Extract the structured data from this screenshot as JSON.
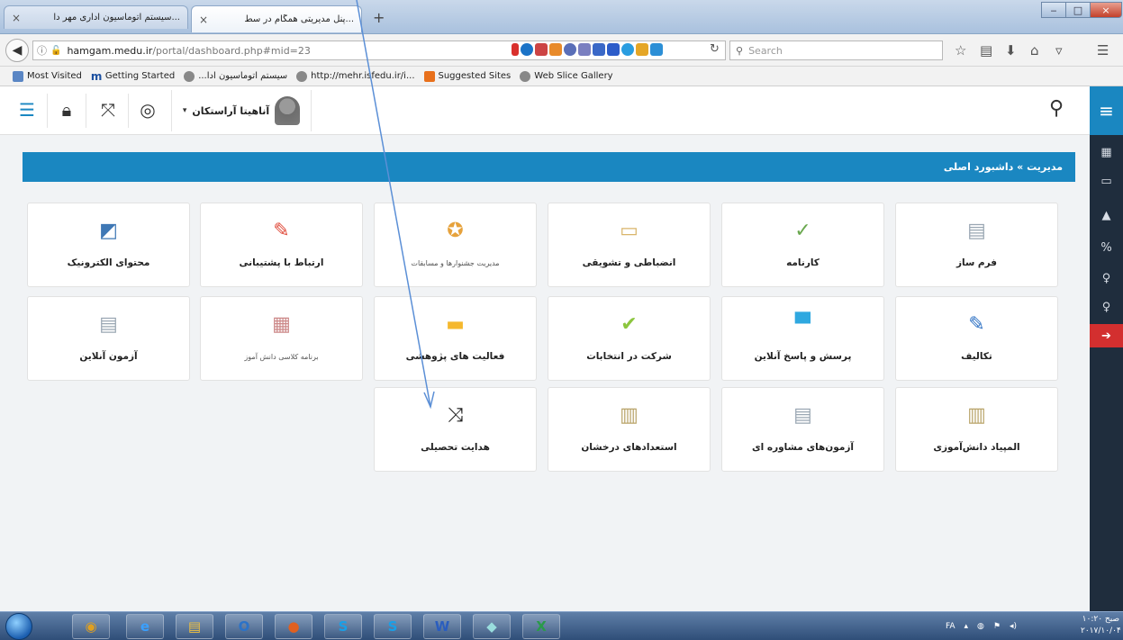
{
  "browser": {
    "tabs": [
      {
        "label": "...سیستم اتوماسیون اداری مهر دا",
        "close": "×"
      },
      {
        "label": "...پنل مدیریتی همگام در سط",
        "close": "×"
      }
    ],
    "new_tab": "+",
    "window_buttons": {
      "minimize": "‒",
      "maximize": "□",
      "close": "×"
    },
    "url_host": "hamgam.medu.ir",
    "url_path": "/portal/dashboard.php#mid=23",
    "search_placeholder": "Search",
    "bookmarks": [
      "Most Visited",
      "Getting Started",
      "...سیستم اتوماسیون ادا",
      "http://mehr.isfedu.ir/i...",
      "Suggested Sites",
      "Web Slice Gallery"
    ]
  },
  "header": {
    "user_name": "آناهیتا آراستکان",
    "user_caret": "▾"
  },
  "main": {
    "breadcrumb": "مدیریت » داشبورد اصلی",
    "tiles": [
      {
        "label": "فرم ساز",
        "icon": "form-icon",
        "color": "#9aa7b3"
      },
      {
        "label": "کارنامه",
        "icon": "report-card-icon",
        "color": "#6aa84f"
      },
      {
        "label": "انضباطی و تشویقی",
        "icon": "folder-doc-icon",
        "color": "#d9b56b"
      },
      {
        "label": "مدیریت جشنوارها و مسابقات",
        "icon": "award-icon",
        "color": "#e6a23c",
        "small": true
      },
      {
        "label": "ارتباط با پشتیبانی",
        "icon": "pencil-red-icon",
        "color": "#e04b3b"
      },
      {
        "label": "محتوای الکترونیک",
        "icon": "presentation-icon",
        "color": "#3f78b5"
      },
      {
        "label": "تکالیف",
        "icon": "pencil-blue-icon",
        "color": "#2f72c4"
      },
      {
        "label": "پرسش و پاسخ آنلاین",
        "icon": "chat-bubble-icon",
        "color": "#2fa8e0"
      },
      {
        "label": "شرکت در انتخابات",
        "icon": "checkmark-icon",
        "color": "#8cc63f"
      },
      {
        "label": "فعالیت های پژوهشی",
        "icon": "folder-icon",
        "color": "#f5b82e"
      },
      {
        "label": "برنامه کلاسی دانش آموز",
        "icon": "calendar-icon",
        "color": "#c88",
        "small": true
      },
      {
        "label": "آزمون آنلاین",
        "icon": "exam-doc-icon",
        "color": "#9aa7b3"
      },
      {
        "label": "المپیاد دانش‌آموزی",
        "icon": "book-icon",
        "color": "#b9a46a"
      },
      {
        "label": "آزمون‌های مشاوره ای",
        "icon": "exam-doc-icon",
        "color": "#9aa7b3"
      },
      {
        "label": "استعدادهای درخشان",
        "icon": "book-icon",
        "color": "#b9a46a"
      },
      {
        "label": "هدایت تحصیلی",
        "icon": "shuffle-icon",
        "color": "#222"
      }
    ]
  },
  "taskbar": {
    "lang": "FA",
    "clock_time": "صبح ۱۰:۲۰",
    "clock_date": "۲۰۱۷/۱۰/۰۴"
  }
}
